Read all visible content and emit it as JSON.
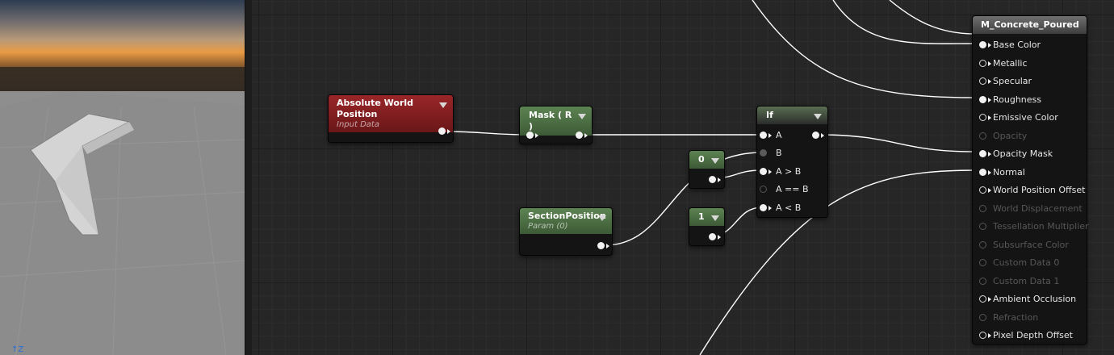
{
  "viewport": {
    "axis_label": "Z"
  },
  "nodes": {
    "absolute_world_position": {
      "title": "Absolute World Position",
      "subtitle": "Input Data"
    },
    "mask": {
      "title": "Mask ( R )"
    },
    "section_position": {
      "title": "SectionPosition",
      "subtitle": "Param (0)"
    },
    "const_zero": {
      "value": "0"
    },
    "const_one": {
      "value": "1"
    },
    "if_node": {
      "title": "If",
      "inputs": [
        "A",
        "B",
        "A > B",
        "A == B",
        "A < B"
      ]
    }
  },
  "material": {
    "title": "M_Concrete_Poured",
    "pins": [
      {
        "label": "Base Color",
        "state": "connected"
      },
      {
        "label": "Metallic",
        "state": "open"
      },
      {
        "label": "Specular",
        "state": "open"
      },
      {
        "label": "Roughness",
        "state": "connected"
      },
      {
        "label": "Emissive Color",
        "state": "open"
      },
      {
        "label": "Opacity",
        "state": "disabled"
      },
      {
        "label": "Opacity Mask",
        "state": "connected"
      },
      {
        "label": "Normal",
        "state": "connected"
      },
      {
        "label": "World Position Offset",
        "state": "open"
      },
      {
        "label": "World Displacement",
        "state": "disabled"
      },
      {
        "label": "Tessellation Multiplier",
        "state": "disabled"
      },
      {
        "label": "Subsurface Color",
        "state": "disabled"
      },
      {
        "label": "Custom Data 0",
        "state": "disabled"
      },
      {
        "label": "Custom Data 1",
        "state": "disabled"
      },
      {
        "label": "Ambient Occlusion",
        "state": "open"
      },
      {
        "label": "Refraction",
        "state": "disabled"
      },
      {
        "label": "Pixel Depth Offset",
        "state": "open"
      }
    ]
  },
  "colors": {
    "graph_bg": "#262626",
    "param_header": "#5d8352",
    "input_header": "#9a2628",
    "wire": "#ffffff"
  }
}
